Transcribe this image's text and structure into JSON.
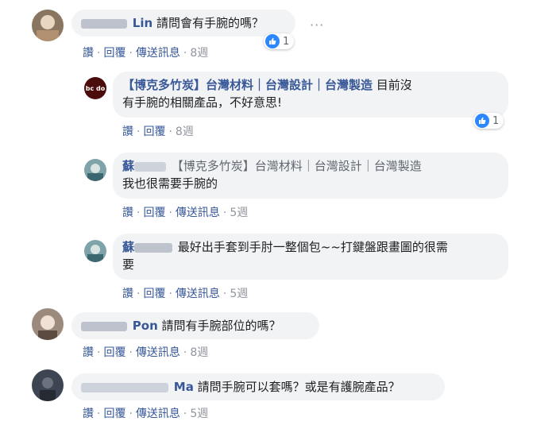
{
  "actions": {
    "like": "讚",
    "reply": "回覆",
    "send": "傳送訊息",
    "sep": "·"
  },
  "comments": [
    {
      "name": "Lin",
      "text": "請問會有手腕的嗎？",
      "time": "8週",
      "reactions": "1",
      "more": "···"
    },
    {
      "name": "【博克多竹炭】台灣材料｜台灣設計｜台灣製造",
      "text_line1": "目前沒",
      "text_line2": "有手腕的相關產品，不好意思!",
      "time": "8週",
      "reactions": "1",
      "logo_text": "bc do"
    },
    {
      "name": "蘇",
      "tag": "【博克多竹炭】台灣材料｜台灣設計｜台灣製造",
      "text": "我也很需要手腕的",
      "time": "5週"
    },
    {
      "name": "蘇",
      "text_line1": "最好出手套到手肘一整個包~~打鍵盤跟畫圖的很需",
      "text_line2": "要",
      "time": "5週"
    },
    {
      "name": "Pon",
      "text": "請問有手腕部位的嗎？",
      "time": "8週"
    },
    {
      "name": "Ma",
      "text": "請問手腕可以套嗎？或是有護腕產品？",
      "time": "5週"
    }
  ]
}
